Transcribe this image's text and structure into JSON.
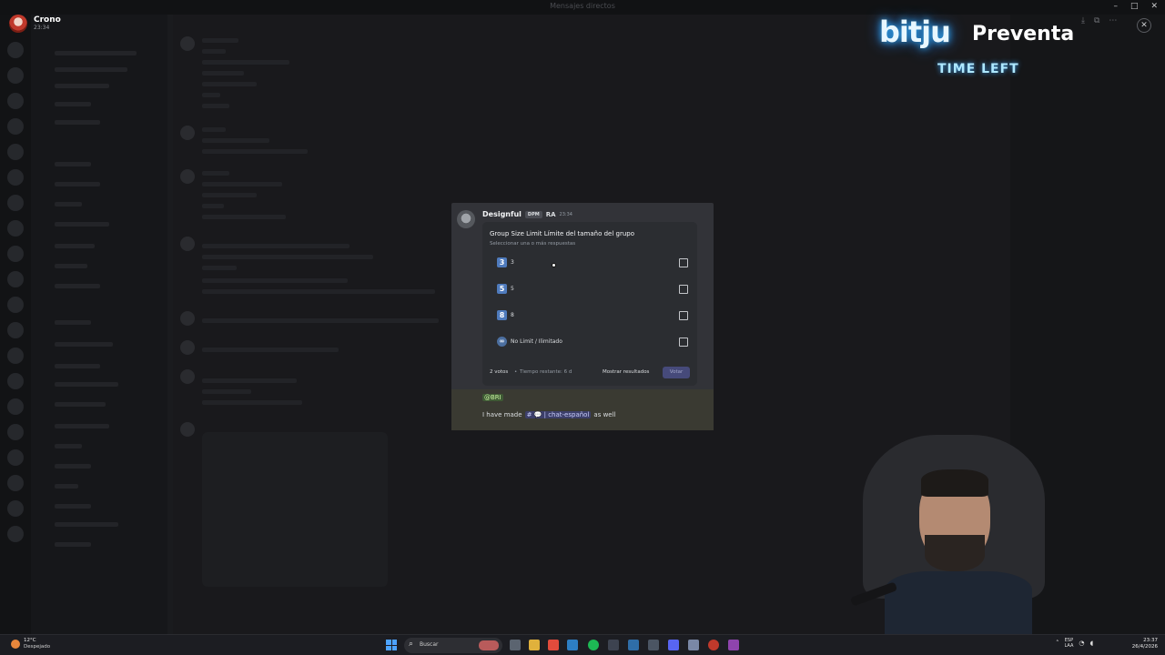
{
  "window": {
    "title": "Mensajes directos"
  },
  "profile": {
    "name": "Crono",
    "time": "23:34"
  },
  "overlay": {
    "logo": "bitju",
    "title": "Preventa",
    "subtitle": "TIME LEFT"
  },
  "message": {
    "author": "Designful",
    "tag": "DPM",
    "tag2": "RA",
    "timestamp": "23:34",
    "poll": {
      "question": "Group Size Limit Límite del tamaño del grupo",
      "hint": "Seleccionar una o más respuestas",
      "options": [
        {
          "emoji": "3",
          "label": "3",
          "checked": false
        },
        {
          "emoji": "5",
          "label": "5",
          "checked": false
        },
        {
          "emoji": "8",
          "label": "8",
          "checked": false
        },
        {
          "emoji": "∞",
          "label": "No Limit / Ilimitado",
          "checked": false
        }
      ],
      "votes": "2 votos",
      "separator": "•",
      "remaining": "Tiempo restante: 6 d",
      "show_results": "Mostrar resultados",
      "vote_button": "Votar"
    },
    "mention": "@BRI",
    "followup": {
      "prefix": "I have made",
      "channel_hash": "#",
      "channel": "💬 | chat-español",
      "suffix": "as well"
    }
  },
  "taskbar": {
    "weather_temp": "12°C",
    "weather_desc": "Despejado",
    "search_placeholder": "Buscar",
    "lang_top": "ESP",
    "lang_bottom": "LAA",
    "time": "23:37",
    "date": "26/4/2026"
  }
}
